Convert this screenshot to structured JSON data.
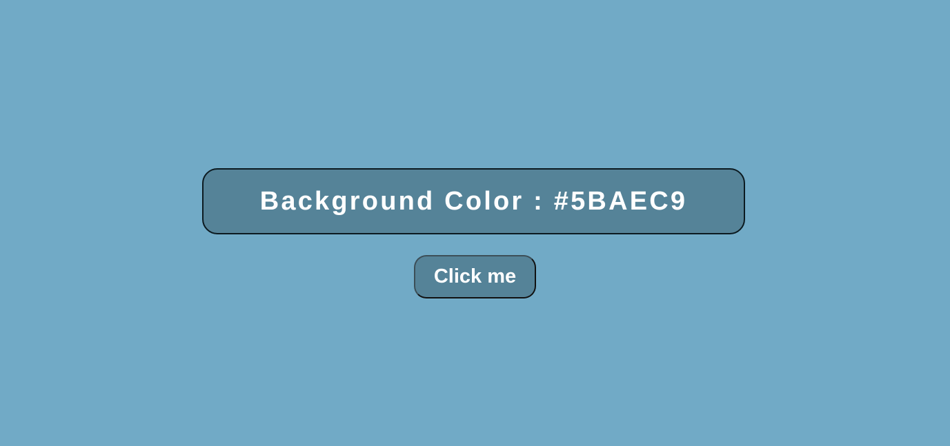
{
  "page": {
    "background_color": "#71AAC6"
  },
  "color_display": {
    "text": "Background Color : #5BAEC9",
    "box_color": "#558398",
    "text_color": "#FFFFFF"
  },
  "action": {
    "button_label": "Click me"
  }
}
